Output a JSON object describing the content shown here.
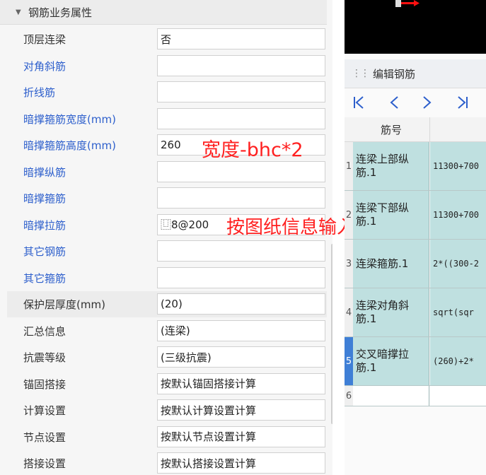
{
  "left_panel": {
    "section_title": "钢筋业务属性",
    "rows": [
      {
        "label": "顶层连梁",
        "value": "否",
        "label_color": "dark"
      },
      {
        "label": "对角斜筋",
        "value": "",
        "label_color": "blue"
      },
      {
        "label": "折线筋",
        "value": "",
        "label_color": "blue"
      },
      {
        "label": "暗撑箍筋宽度(mm)",
        "value": "",
        "label_color": "blue"
      },
      {
        "label": "暗撑箍筋高度(mm)",
        "value": "260",
        "label_color": "blue"
      },
      {
        "label": "暗撑纵筋",
        "value": "",
        "label_color": "blue"
      },
      {
        "label": "暗撑箍筋",
        "value": "",
        "label_color": "blue"
      },
      {
        "label": "暗撑拉筋",
        "value": "⿶8@200",
        "label_color": "blue"
      },
      {
        "label": "其它钢筋",
        "value": "",
        "label_color": "blue"
      },
      {
        "label": "其它箍筋",
        "value": "",
        "label_color": "blue"
      },
      {
        "label": "保护层厚度(mm)",
        "value": "(20)",
        "label_color": "dark",
        "gray": true
      },
      {
        "label": "汇总信息",
        "value": "(连梁)",
        "label_color": "dark"
      },
      {
        "label": "抗震等级",
        "value": "(三级抗震)",
        "label_color": "dark"
      },
      {
        "label": "锚固搭接",
        "value": "按默认锚固搭接计算",
        "label_color": "dark"
      },
      {
        "label": "计算设置",
        "value": "按默认计算设置计算",
        "label_color": "dark"
      },
      {
        "label": "节点设置",
        "value": "按默认节点设置计算",
        "label_color": "dark"
      },
      {
        "label": "搭接设置",
        "value": "按默认搭接设置计算",
        "label_color": "dark"
      }
    ]
  },
  "annotations": {
    "width_note": "宽度-bhc*2",
    "input_note": "按图纸信息输入"
  },
  "right_panel": {
    "editor_title": "编辑钢筋",
    "nav_icons": [
      "first-icon",
      "prev-icon",
      "next-icon",
      "last-icon"
    ],
    "grid_header": "筋号",
    "grid_rows": [
      {
        "index": "1",
        "name": "连梁上部纵筋.1",
        "formula": "11300+700"
      },
      {
        "index": "2",
        "name": "连梁下部纵筋.1",
        "formula": "11300+700"
      },
      {
        "index": "3",
        "name": "连梁箍筋.1",
        "formula": "2*((300-2"
      },
      {
        "index": "4",
        "name": "连梁对角斜筋.1",
        "formula": "sqrt(sqr"
      },
      {
        "index": "5",
        "name": "交叉暗撑拉筋.1",
        "formula": "(260)+2*",
        "selected": true
      },
      {
        "index": "6",
        "name": "",
        "formula": ""
      }
    ]
  },
  "colors": {
    "label_blue": "#2d5fcc",
    "annotation_red": "#ff2020",
    "grid_row_bg": "#bfe0e0",
    "selected_index_bg": "#3f7fd6"
  }
}
